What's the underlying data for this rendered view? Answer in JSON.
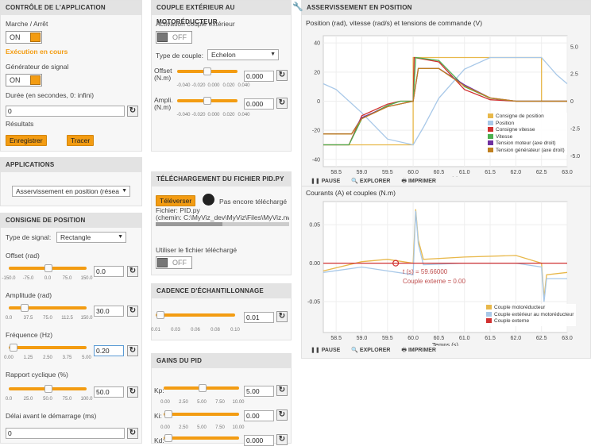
{
  "controle": {
    "header": "CONTRÔLE DE L'APPLICATION",
    "marche_label": "Marche / Arrêt",
    "marche_value": "ON",
    "status": "Exécution en cours",
    "generateur_label": "Générateur de signal",
    "generateur_value": "ON",
    "duree_label": "Durée (en secondes, 0: infini)",
    "duree_value": "0",
    "resultats_label": "Résultats",
    "enregistrer": "Enregistrer",
    "tracer": "Tracer"
  },
  "applications": {
    "header": "APPLICATIONS",
    "selected": "Asservissement en position (résea"
  },
  "consigne": {
    "header": "CONSIGNE DE POSITION",
    "type_label": "Type de signal:",
    "type_value": "Rectangle",
    "offset_label": "Offset (rad)",
    "offset_value": "0.0",
    "offset_ticks": [
      "-150.0",
      "-75.0",
      "0.0",
      "75.0",
      "150.0"
    ],
    "amplitude_label": "Amplitude (rad)",
    "amplitude_value": "30.0",
    "amplitude_ticks": [
      "0.0",
      "37.5",
      "75.0",
      "112.5",
      "150.0"
    ],
    "frequence_label": "Fréquence (Hz)",
    "frequence_value": "0.20",
    "frequence_ticks": [
      "0.00",
      "1.25",
      "2.50",
      "3.75",
      "5.00"
    ],
    "rapport_label": "Rapport cyclique (%)",
    "rapport_value": "50.0",
    "rapport_ticks": [
      "0.0",
      "25.0",
      "50.0",
      "75.0",
      "100.0"
    ],
    "delai_label": "Délai avant le démarrage (ms)",
    "delai_value": "0"
  },
  "couple_ext": {
    "header": "COUPLE EXTÉRIEUR AU MOTORÉDUCTEUR",
    "activation_label": "Activation couple extérieur",
    "activation_value": "OFF",
    "type_label": "Type de couple:",
    "type_value": "Echelon",
    "offset_label": "Offset\n(N.m)",
    "offset_value": "0.000",
    "ampli_label": "Ampli.\n(N.m)",
    "ampli_value": "0.000",
    "ticks": [
      "-0.040",
      "-0.020",
      "0.000",
      "0.020",
      "0.040"
    ]
  },
  "telechargement": {
    "header": "TÉLÉCHARGEMENT DU FICHIER PID.PY",
    "televerser": "Téléverser",
    "status": "Pas encore téléchargé",
    "fichier": "Fichier: PID.py",
    "chemin": "(chemin: C:\\MyViz_dev\\MyViz\\Files\\MyViz.nw/",
    "utiliser_label": "Utiliser le fichier téléchargé",
    "utiliser_value": "OFF"
  },
  "cadence": {
    "header": "CADENCE D'ÉCHANTILLONNAGE",
    "value": "0.01",
    "ticks": [
      "0.01",
      "0.03",
      "0.06",
      "0.08",
      "0.10"
    ]
  },
  "gains": {
    "header": "GAINS DU PID",
    "kp_label": "Kp:",
    "kp_value": "5.00",
    "ki_label": "Ki:",
    "ki_value": "0.00",
    "kd_label": "Kd:",
    "kd_value": "0.000",
    "ticks": [
      "0.00",
      "2.50",
      "5.00",
      "7.50",
      "10.00"
    ]
  },
  "asserv": {
    "header": "ASSERVISSEMENT EN POSITION",
    "toolbar": {
      "pause": "PAUSE",
      "explorer": "EXPLORER",
      "imprimer": "IMPRIMER"
    }
  },
  "chart_data": [
    {
      "type": "line",
      "title": "Position (rad), vitesse (rad/s) et tensions de commande (V)",
      "xlabel": "Temps (s)",
      "xlim": [
        58.25,
        63.0
      ],
      "ylim_left": [
        -45,
        45
      ],
      "ylim_right": [
        -6,
        6
      ],
      "x_ticks": [
        "58.5",
        "59.0",
        "59.5",
        "60.0",
        "60.5",
        "61.0",
        "61.5",
        "62.0",
        "62.5",
        "63.0"
      ],
      "y_ticks_left": [
        "-40",
        "-20",
        "0",
        "20",
        "40"
      ],
      "y_ticks_right": [
        "-5.0",
        "-2.5",
        "0",
        "2.5",
        "5.0"
      ],
      "colors": {
        "consigne_position": "#e8b84a",
        "position": "#a8c8e8",
        "consigne_vitesse": "#d13030",
        "vitesse": "#4caf50",
        "tension_moteur": "#7030a0",
        "tension_generateur": "#c08020"
      },
      "series": [
        {
          "name": "Consigne de position",
          "x": [
            58.25,
            60.0,
            60.0,
            62.5,
            62.5,
            63.0
          ],
          "values": [
            -30,
            -30,
            30,
            30,
            0,
            0
          ]
        },
        {
          "name": "Position",
          "x": [
            58.25,
            58.5,
            59.0,
            59.5,
            60.0,
            60.2,
            60.5,
            61.0,
            61.5,
            62.0,
            62.5,
            62.8,
            63.0
          ],
          "values": [
            12,
            8,
            -8,
            -26,
            -30,
            -18,
            2,
            22,
            30,
            30,
            30,
            18,
            12
          ]
        },
        {
          "name": "Consigne vitesse",
          "x": [
            58.25,
            58.75,
            59.0,
            59.5,
            59.75,
            60.0,
            60.02,
            60.5,
            61.0,
            61.5,
            62.0,
            62.5,
            63.0
          ],
          "values": [
            -30,
            -30,
            -10,
            -2,
            0,
            0,
            30,
            27,
            8,
            1,
            0,
            0,
            0
          ]
        },
        {
          "name": "Vitesse",
          "x": [
            58.25,
            58.75,
            59.0,
            59.5,
            59.75,
            60.0,
            60.05,
            60.5,
            61.0,
            61.5,
            62.0,
            62.5,
            63.0
          ],
          "values": [
            -30,
            -30,
            -12,
            -3,
            0,
            0,
            30,
            28,
            10,
            2,
            0,
            0,
            0
          ]
        },
        {
          "name": "Tension moteur (axe droit)",
          "x": [
            58.25,
            58.8,
            59.0,
            59.5,
            60.0,
            60.1,
            60.5,
            61.0,
            61.5,
            62.0,
            63.0
          ],
          "values": [
            -3.0,
            -3.0,
            -1.5,
            -0.5,
            0,
            3.0,
            3.0,
            1.5,
            0.3,
            0,
            0
          ]
        },
        {
          "name": "Tension générateur (axe droit)",
          "x": [
            58.25,
            58.8,
            59.0,
            59.5,
            60.0,
            60.1,
            60.5,
            61.0,
            61.5,
            62.0,
            63.0
          ],
          "values": [
            -3.0,
            -3.0,
            -1.6,
            -0.5,
            0,
            3.0,
            3.0,
            1.4,
            0.3,
            0,
            0
          ]
        }
      ],
      "legend_position": "bottom-right"
    },
    {
      "type": "line",
      "title": "Courants (A) et couples (N.m)",
      "xlabel": "Temps (s)",
      "xlim": [
        58.25,
        63.0
      ],
      "ylim": [
        -0.09,
        0.08
      ],
      "x_ticks": [
        "58.5",
        "59.0",
        "59.5",
        "60.0",
        "60.5",
        "61.0",
        "61.5",
        "62.0",
        "62.5",
        "63.0"
      ],
      "y_ticks": [
        "-0.05",
        "0.00",
        "0.05"
      ],
      "colors": {
        "couple_moteur": "#e8b84a",
        "couple_exterieur": "#a8c8e8",
        "couple_externe": "#d13030"
      },
      "series": [
        {
          "name": "Couple motoréducteur",
          "x": [
            58.25,
            59.0,
            59.5,
            60.0,
            60.05,
            60.1,
            60.2,
            61.0,
            62.0,
            62.5,
            62.55,
            62.6,
            63.0
          ],
          "values": [
            -0.01,
            0.002,
            0.005,
            0.0,
            0.07,
            0.03,
            0.005,
            0.008,
            0.01,
            0.0,
            -0.045,
            -0.015,
            -0.012
          ]
        },
        {
          "name": "Couple extérieur au motoréducteur",
          "x": [
            58.25,
            59.0,
            59.5,
            60.0,
            60.05,
            60.1,
            60.2,
            61.0,
            62.0,
            62.5,
            62.55,
            62.6,
            63.0
          ],
          "values": [
            -0.012,
            -0.005,
            -0.01,
            -0.015,
            0.068,
            0.025,
            -0.002,
            0.0,
            0.0,
            -0.005,
            -0.05,
            -0.02,
            -0.02
          ]
        },
        {
          "name": "Couple externe",
          "x": [
            58.25,
            63.0
          ],
          "values": [
            0.0,
            0.0
          ]
        }
      ],
      "tooltip": {
        "t": "t (s) = 59.66000",
        "value": "Couple externe = 0.00"
      },
      "legend_position": "bottom-right"
    }
  ]
}
